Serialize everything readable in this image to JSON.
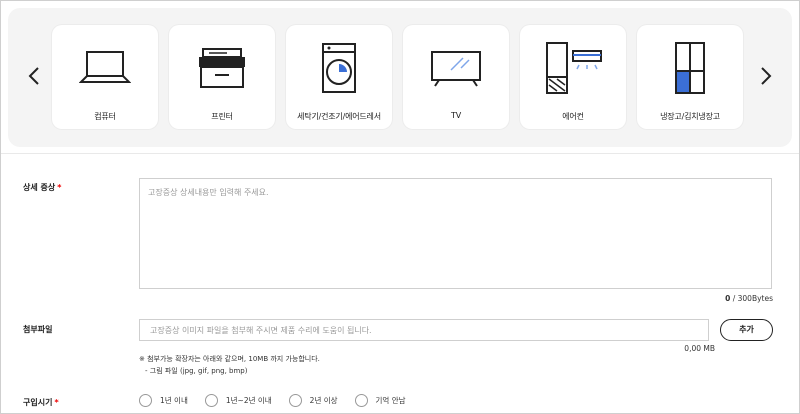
{
  "categories": [
    {
      "label": "컴퓨터",
      "icon": "laptop-icon"
    },
    {
      "label": "프린터",
      "icon": "printer-icon"
    },
    {
      "label": "세탁기/건조기/에어드레서",
      "icon": "washing-machine-icon"
    },
    {
      "label": "TV",
      "icon": "tv-icon"
    },
    {
      "label": "에어컨",
      "icon": "air-conditioner-icon"
    },
    {
      "label": "냉장고/김치냉장고",
      "icon": "refrigerator-icon"
    }
  ],
  "nav": {
    "prev_icon": "chevron-left-icon",
    "next_icon": "chevron-right-icon"
  },
  "detail": {
    "label": "상세 증상",
    "required_mark": "*",
    "placeholder": "고장증상 상세내용만 입력해 주세요.",
    "byte_count": "0",
    "byte_limit": " / 300Bytes"
  },
  "attachment": {
    "label": "첨부파일",
    "placeholder": "고장증상 이미지 파일을 첨부해 주시면 제품 수리에 도움이 됩니다.",
    "add_button": "추가",
    "size": "0,00 MB",
    "note_line1": "※ 첨부가능 확장자는 아래와 같으며, 10MB 까지 가능합니다.",
    "note_line2": "- 그림 파일 (jpg, gif, png, bmp)"
  },
  "purchase": {
    "label": "구입시기",
    "required_mark": "*",
    "options": [
      "1년 이내",
      "1년~2년 이내",
      "2년 이상",
      "기억 안남"
    ]
  },
  "colors": {
    "required": "#e00000",
    "icon_blue": "#3b6fd6",
    "panel_bg": "#f4f4f4"
  }
}
